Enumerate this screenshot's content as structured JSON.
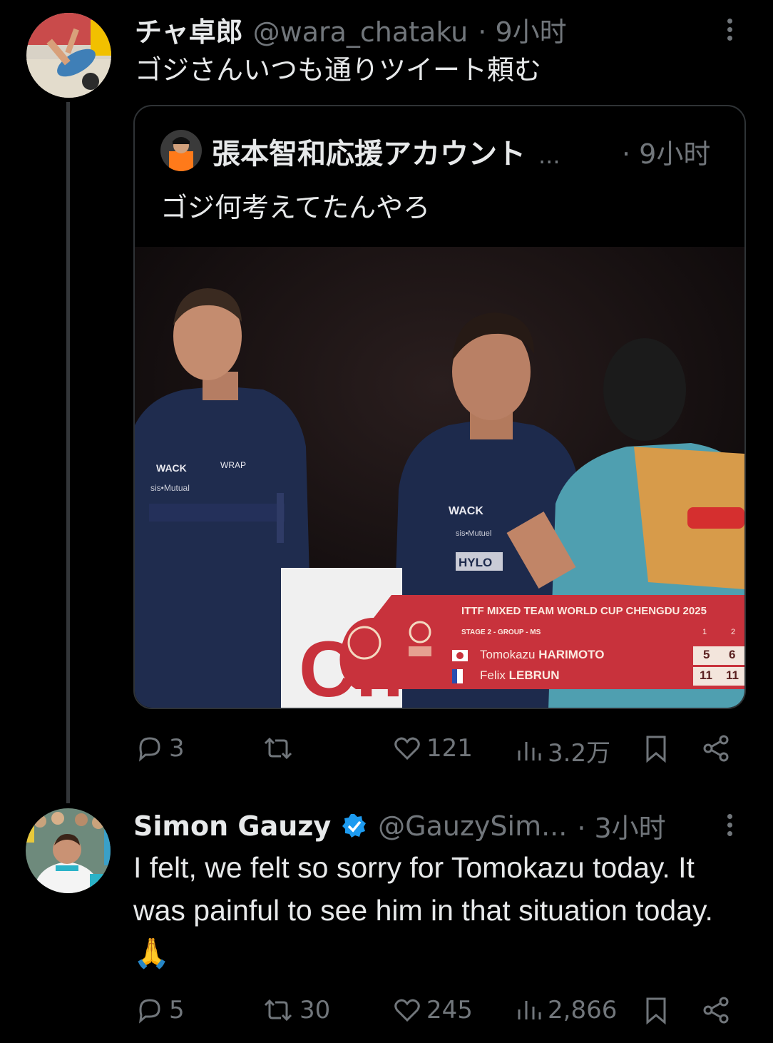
{
  "tweet1": {
    "name": "チャ卓郎",
    "handle": "@wara_chataku",
    "time": "· 9小时",
    "text": "ゴジさんいつも通りツイート頼む",
    "quote": {
      "name": "張本智和応援アカウント",
      "ellipsis": "...",
      "time": "· 9小时",
      "text": "ゴジ何考えてたんやろ",
      "video": {
        "event": "ITTF MIXED TEAM WORLD CUP CHENGDU 2025",
        "stage": "STAGE 2 - GROUP - MS",
        "col1": "1",
        "col2": "2",
        "player1": {
          "first": "Tomokazu",
          "last": "HARIMOTO",
          "g1": "5",
          "g2": "6"
        },
        "player2": {
          "first": "Felix",
          "last": "LEBRUN",
          "g1": "11",
          "g2": "11"
        }
      }
    },
    "actions": {
      "replies": "3",
      "retweets": "",
      "likes": "121",
      "views": "3.2万"
    }
  },
  "tweet2": {
    "name": "Simon Gauzy",
    "handle": "@GauzySim...",
    "time": "· 3小时",
    "text": "I felt, we felt so sorry for Tomokazu today. It was painful to see him in that situation today. 🙏",
    "actions": {
      "replies": "5",
      "retweets": "30",
      "likes": "245",
      "views": "2,866"
    }
  },
  "colors": {
    "background": "#000000",
    "text": "#e7e9ea",
    "muted": "#71767b",
    "verified": "#1d9bf0",
    "border": "#2f3336",
    "scoreboard": "#c8323c"
  }
}
